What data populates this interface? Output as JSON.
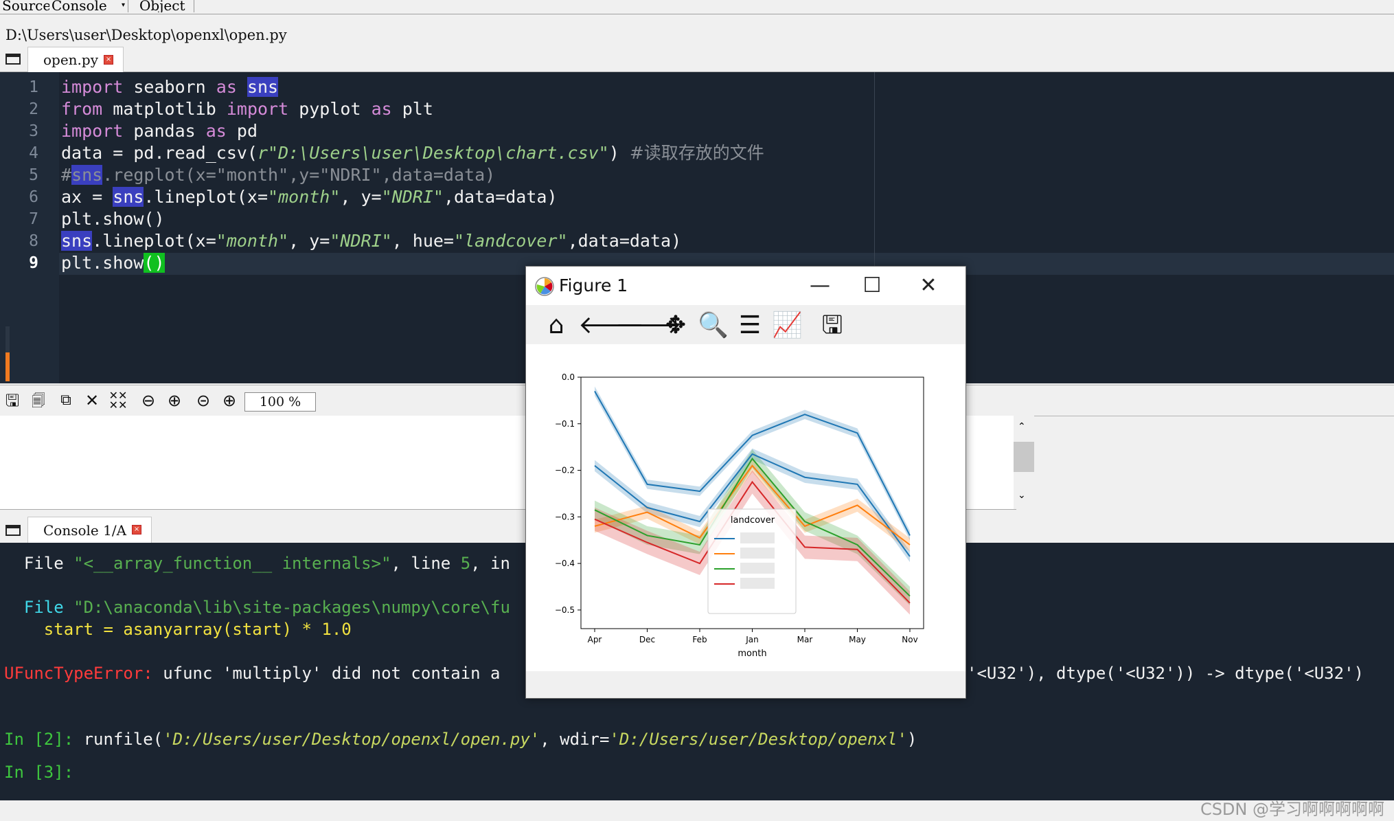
{
  "top_tabs": [
    {
      "label": "Source"
    },
    {
      "label": "Console"
    },
    {
      "label": "Object"
    }
  ],
  "file_path": "D:\\Users\\user\\Desktop\\openxl\\open.py",
  "editor_tab": {
    "label": "open.py"
  },
  "code_lines": [
    {
      "num": "1"
    },
    {
      "num": "2"
    },
    {
      "num": "3"
    },
    {
      "num": "4"
    },
    {
      "num": "5"
    },
    {
      "num": "6"
    },
    {
      "num": "7"
    },
    {
      "num": "8"
    },
    {
      "num": "9"
    }
  ],
  "code_tokens": {
    "l1": [
      "import",
      " seaborn ",
      "as",
      " ",
      "sns"
    ],
    "l2": [
      "from",
      " matplotlib ",
      "import",
      " pyplot ",
      "as",
      " plt"
    ],
    "l3": [
      "import",
      " pandas ",
      "as",
      " pd"
    ],
    "l4": [
      "data = pd.read_csv(",
      "r\"D:\\Users\\user\\Desktop\\chart.csv\"",
      ") ",
      "#读取存放的文件"
    ],
    "l5": [
      "#",
      "sns",
      ".regplot(x=\"month\",y=\"NDRI\",data=data)"
    ],
    "l6": [
      "ax = ",
      "sns",
      ".lineplot(x=",
      "\"month\"",
      ", y=",
      "\"NDRI\"",
      ",data=data)"
    ],
    "l7": [
      "plt.show()"
    ],
    "l8": [
      "sns",
      ".lineplot(x=",
      "\"month\"",
      ", y=",
      "\"NDRI\"",
      ", hue=",
      "\"landcover\"",
      ",data=data)"
    ],
    "l9": [
      "plt.show",
      "()"
    ]
  },
  "plot_toolbar": {
    "zoom": "100 %"
  },
  "console_tab": {
    "label": "Console 1/A"
  },
  "console": {
    "line1": [
      "  File ",
      "\"<__array_function__ internals>\"",
      ", line ",
      "5",
      ", in"
    ],
    "line2": [
      "  File ",
      "\"D:\\anaconda\\lib\\site-packages\\numpy\\core\\fu"
    ],
    "line3": "    start = asanyarray(start) * 1.0",
    "line4a": "UFuncTypeError: ",
    "line4b": "ufunc 'multiply' did not contain a",
    "line4c": "'<U32'), dtype('<U32')) -> dtype('<U32')",
    "line5": [
      "In [2]: ",
      "runfile(",
      "'D:/Users/user/Desktop/openxl/open.py'",
      ", wdir=",
      "'D:/Users/user/Desktop/openxl'",
      ")"
    ],
    "line6": "In [3]:"
  },
  "figure_window": {
    "title": "Figure 1",
    "tool_icons": [
      "home-icon",
      "back-icon",
      "forward-icon",
      "pan-icon",
      "zoom-icon",
      "configure-icon",
      "edit-axis-icon",
      "save-icon"
    ]
  },
  "chart_data": {
    "type": "line",
    "title": "",
    "xlabel": "month",
    "ylabel": "",
    "categories": [
      "Apr",
      "Dec",
      "Feb",
      "Jan",
      "Mar",
      "May",
      "Nov"
    ],
    "ylim": [
      -0.54,
      0.0
    ],
    "yticks": [
      "0.0",
      "−0.1",
      "−0.2",
      "−0.3",
      "−0.4",
      "−0.5"
    ],
    "legend_title": "landcover",
    "legend_placement": "lower-center",
    "series": [
      {
        "color": "#1f77b4",
        "values": [
          -0.03,
          -0.23,
          -0.245,
          -0.125,
          -0.08,
          -0.12,
          -0.34
        ],
        "ci": 0.01
      },
      {
        "color": "#1f77b4",
        "values": [
          -0.19,
          -0.28,
          -0.31,
          -0.165,
          -0.215,
          -0.23,
          -0.385
        ],
        "ci": 0.012
      },
      {
        "color": "#ff7f0e",
        "values": [
          -0.32,
          -0.29,
          -0.345,
          -0.19,
          -0.32,
          -0.275,
          -0.36
        ],
        "ci": 0.014
      },
      {
        "color": "#2ca02c",
        "values": [
          -0.285,
          -0.34,
          -0.36,
          -0.175,
          -0.31,
          -0.36,
          -0.47
        ],
        "ci": 0.02
      },
      {
        "color": "#d62728",
        "values": [
          -0.305,
          -0.355,
          -0.4,
          -0.225,
          -0.365,
          -0.37,
          -0.485
        ],
        "ci": 0.025
      }
    ],
    "legend_colors": [
      "#1f77b4",
      "#ff7f0e",
      "#2ca02c",
      "#d62728"
    ]
  },
  "watermark": "CSDN @学习啊啊啊啊啊"
}
